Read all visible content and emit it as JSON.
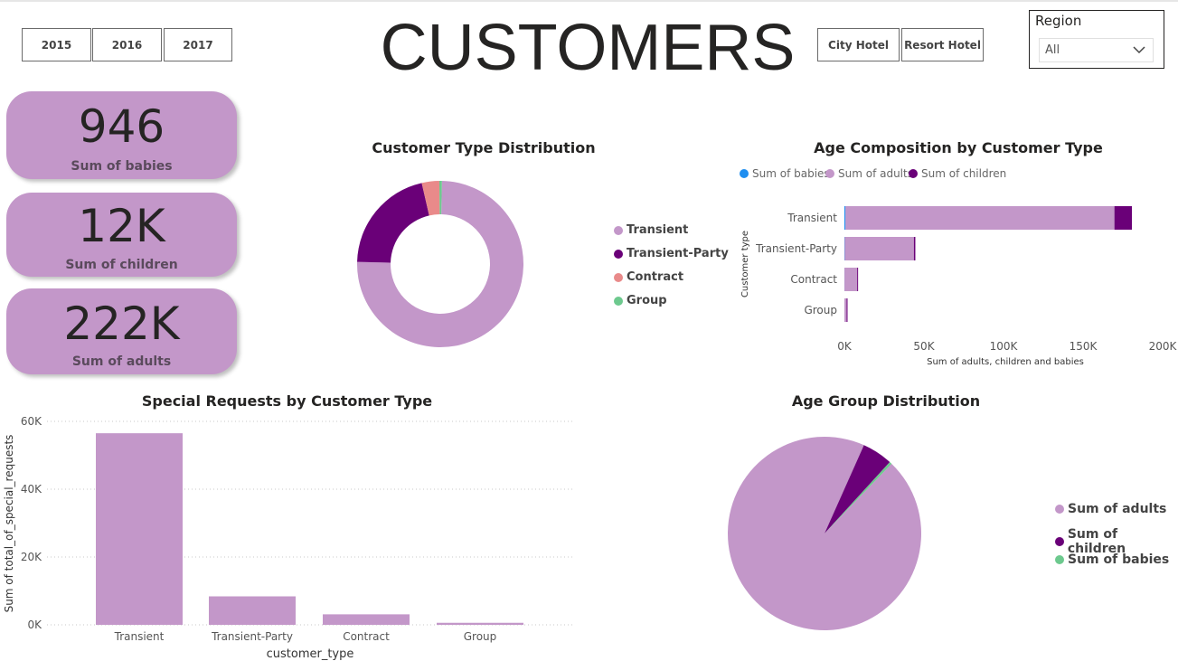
{
  "header": {
    "title": "CUSTOMERS",
    "year_buttons": [
      "2015",
      "2016",
      "2017"
    ],
    "hotel_buttons": [
      "City Hotel",
      "Resort Hotel"
    ],
    "region": {
      "label": "Region",
      "value": "All"
    }
  },
  "cards": [
    {
      "value": "946",
      "label": "Sum of babies"
    },
    {
      "value": "12K",
      "label": "Sum of children"
    },
    {
      "value": "222K",
      "label": "Sum of adults"
    }
  ],
  "colors": {
    "light_purple": "#c397c9",
    "dark_purple": "#6a0078",
    "salmon": "#e98a8a",
    "green": "#6dc98e",
    "blue": "#1f8ef0"
  },
  "chart_data": [
    {
      "id": "customer-type-distribution",
      "type": "pie",
      "donut": true,
      "title": "Customer Type Distribution",
      "categories": [
        "Transient",
        "Transient-Party",
        "Contract",
        "Group"
      ],
      "values": [
        75.1,
        21.0,
        3.4,
        0.5
      ],
      "colors": [
        "#c397c9",
        "#6a0078",
        "#e98a8a",
        "#6dc98e"
      ]
    },
    {
      "id": "age-composition",
      "type": "bar",
      "orientation": "horizontal",
      "stacked": true,
      "title": "Age Composition by Customer Type",
      "xlabel": "Sum of adults, children and babies",
      "ylabel": "Customer type",
      "categories": [
        "Transient",
        "Transient-Party",
        "Contract",
        "Group"
      ],
      "series": [
        {
          "name": "Sum of babies",
          "color": "#1f8ef0",
          "values": [
            700,
            180,
            30,
            10
          ]
        },
        {
          "name": "Sum of adults",
          "color": "#c397c9",
          "values": [
            169000,
            43500,
            8000,
            1400
          ]
        },
        {
          "name": "Sum of children",
          "color": "#6a0078",
          "values": [
            11000,
            900,
            100,
            30
          ]
        }
      ],
      "xlim": [
        0,
        200000
      ],
      "xticks": [
        "0K",
        "50K",
        "100K",
        "150K",
        "200K"
      ],
      "xtick_values": [
        0,
        50000,
        100000,
        150000,
        200000
      ]
    },
    {
      "id": "special-requests",
      "type": "bar",
      "title": "Special Requests by Customer Type",
      "xlabel": "customer_type",
      "ylabel": "Sum of total_of_special_requests",
      "categories": [
        "Transient",
        "Transient-Party",
        "Contract",
        "Group"
      ],
      "values": [
        56500,
        8400,
        3100,
        600
      ],
      "color": "#c397c9",
      "ylim": [
        0,
        60000
      ],
      "yticks": [
        "0K",
        "20K",
        "40K",
        "60K"
      ],
      "ytick_values": [
        0,
        20000,
        40000,
        60000
      ]
    },
    {
      "id": "age-group-distribution",
      "type": "pie",
      "title": "Age Group Distribution",
      "categories": [
        "Sum of adults",
        "Sum of children",
        "Sum of babies"
      ],
      "values": [
        222000,
        12000,
        946
      ],
      "colors": [
        "#c397c9",
        "#6a0078",
        "#6dc98e"
      ]
    }
  ]
}
